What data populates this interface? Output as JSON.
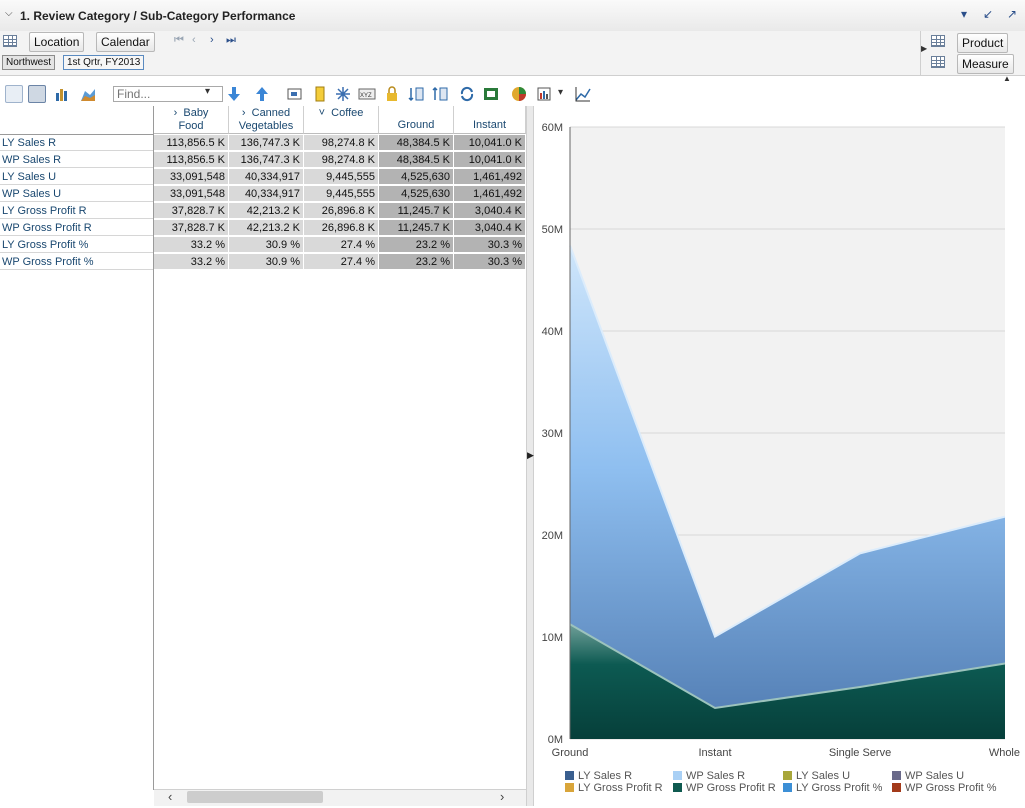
{
  "panel": {
    "title": "1. Review Category / Sub-Category Performance"
  },
  "dimensions": {
    "location_label": "Location",
    "calendar_label": "Calendar",
    "product_label": "Product",
    "measure_label": "Measure",
    "crumb_location": "Northwest",
    "crumb_calendar": "1st Qrtr, FY2013"
  },
  "toolbar": {
    "find_placeholder": "Find...",
    "icons": [
      "grid-view-icon",
      "grid-chart-view-icon",
      "bar-chart-icon",
      "area-chart-icon",
      "sort-down-icon",
      "sort-up-icon",
      "filter-icon",
      "highlight-icon",
      "spread-icon",
      "format-icon",
      "lock-icon",
      "swap-a-icon",
      "swap-b-icon",
      "refresh-icon",
      "export-icon",
      "chart-options-icon",
      "page-setup-icon",
      "chart-settings-icon"
    ]
  },
  "table": {
    "columns": [
      {
        "line1": "Baby",
        "line2": "Food",
        "expand": "›"
      },
      {
        "line1": "Canned",
        "line2": "Vegetables",
        "expand": "›"
      },
      {
        "line1": "Coffee",
        "line2": "",
        "expand": "˅"
      },
      {
        "line1": "",
        "line2": "Ground",
        "expand": ""
      },
      {
        "line1": "",
        "line2": "Instant",
        "expand": ""
      }
    ],
    "rows": [
      {
        "label": "LY Sales R",
        "values": [
          "113,856.5 K",
          "136,747.3 K",
          "98,274.8 K",
          "48,384.5 K",
          "10,041.0 K"
        ]
      },
      {
        "label": "WP Sales R",
        "values": [
          "113,856.5 K",
          "136,747.3 K",
          "98,274.8 K",
          "48,384.5 K",
          "10,041.0 K"
        ]
      },
      {
        "label": "LY Sales U",
        "values": [
          "33,091,548",
          "40,334,917",
          "9,445,555",
          "4,525,630",
          "1,461,492"
        ]
      },
      {
        "label": "WP Sales U",
        "values": [
          "33,091,548",
          "40,334,917",
          "9,445,555",
          "4,525,630",
          "1,461,492"
        ]
      },
      {
        "label": "LY Gross Profit R",
        "values": [
          "37,828.7 K",
          "42,213.2 K",
          "26,896.8 K",
          "11,245.7 K",
          "3,040.4 K"
        ]
      },
      {
        "label": "WP Gross Profit R",
        "values": [
          "37,828.7 K",
          "42,213.2 K",
          "26,896.8 K",
          "11,245.7 K",
          "3,040.4 K"
        ]
      },
      {
        "label": "LY Gross Profit %",
        "values": [
          "33.2 %",
          "30.9 %",
          "27.4 %",
          "23.2 %",
          "30.3 %"
        ]
      },
      {
        "label": "WP Gross Profit %",
        "values": [
          "33.2 %",
          "30.9 %",
          "27.4 %",
          "23.2 %",
          "30.3 %"
        ]
      }
    ]
  },
  "chart_data": {
    "type": "area",
    "categories": [
      "Ground",
      "Instant",
      "Single Serve",
      "Whole"
    ],
    "ylim": [
      0,
      60000000
    ],
    "yticks": [
      "0M",
      "10M",
      "20M",
      "30M",
      "40M",
      "50M",
      "60M"
    ],
    "grid": true,
    "legend_position": "bottom",
    "series": [
      {
        "name": "LY Sales R",
        "color": "#3a5f8f",
        "values": [
          48384500,
          10041000,
          18200000,
          21800000
        ]
      },
      {
        "name": "WP Sales R",
        "color": "#a9d0f5",
        "values": [
          48384500,
          10041000,
          18200000,
          21800000
        ]
      },
      {
        "name": "LY Sales U",
        "color": "#a8a63a",
        "values": [
          4525630,
          1461492,
          2000000,
          2500000
        ]
      },
      {
        "name": "WP Sales U",
        "color": "#6a6a8a",
        "values": [
          4525630,
          1461492,
          2000000,
          2500000
        ]
      },
      {
        "name": "LY Gross Profit R",
        "color": "#d9a53a",
        "values": [
          11245700,
          3040400,
          5100000,
          7400000
        ]
      },
      {
        "name": "WP Gross Profit R",
        "color": "#0f5a50",
        "values": [
          11245700,
          3040400,
          5100000,
          7400000
        ]
      },
      {
        "name": "LY Gross Profit %",
        "color": "#3c8fd6",
        "values": [
          23.2,
          30.3,
          25,
          28
        ]
      },
      {
        "name": "WP Gross Profit %",
        "color": "#a33a1a",
        "values": [
          23.2,
          30.3,
          25,
          28
        ]
      }
    ]
  }
}
